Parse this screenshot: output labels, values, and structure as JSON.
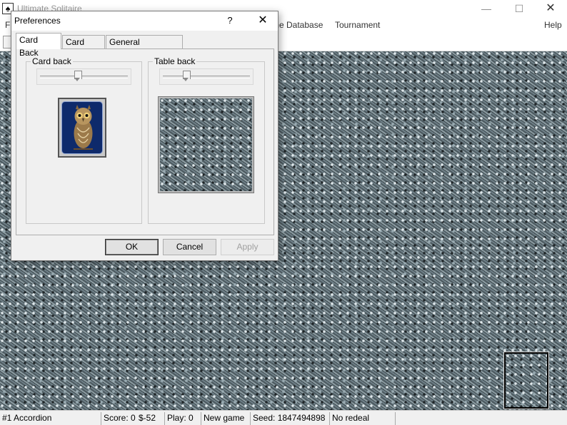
{
  "app": {
    "title": "Ultimate Solitaire",
    "icon": "spade-card-icon",
    "window_controls": {
      "minimize": "—",
      "maximize": "☐",
      "close": "✕"
    }
  },
  "menubar": {
    "items": [
      "F",
      "me Database",
      "Tournament",
      "Help"
    ]
  },
  "dialog": {
    "title": "Preferences",
    "help": "?",
    "close": "✕",
    "tabs": [
      {
        "label": "Card Back",
        "active": true
      },
      {
        "label": "Card Face",
        "active": false
      },
      {
        "label": "General Preferences",
        "active": false
      }
    ],
    "card_back_group": {
      "label": "Card back",
      "slider_value": 0.42,
      "image": "owl-card-back"
    },
    "table_back_group": {
      "label": "Table back",
      "slider_value": 0.25,
      "image": "screws-texture"
    },
    "buttons": {
      "ok": "OK",
      "cancel": "Cancel",
      "apply": "Apply"
    }
  },
  "statusbar": {
    "game": "#1 Accordion",
    "score": "Score: 0",
    "money": "$-52",
    "play": "Play: 0",
    "new_game": "New game",
    "seed": "Seed: 1847494898",
    "redeal": "No redeal"
  },
  "colors": {
    "card_back": "#0e2a6b",
    "table_texture": "#56656c"
  }
}
